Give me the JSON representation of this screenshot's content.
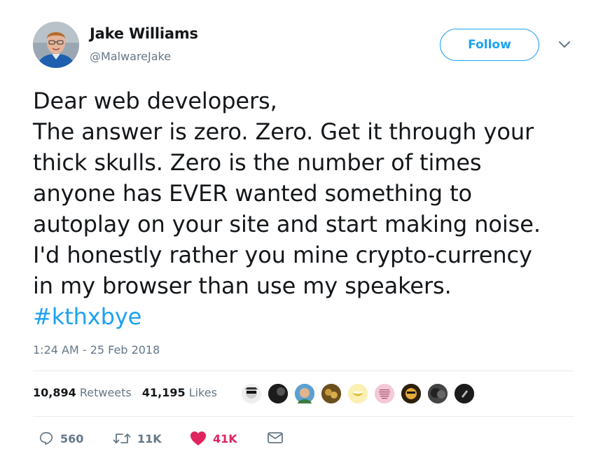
{
  "user": {
    "name": "Jake Williams",
    "handle": "@MalwareJake",
    "avatar_icon": "profile-photo"
  },
  "follow_label": "Follow",
  "tweet": {
    "lines": [
      "Dear web developers,",
      "The answer is zero. Zero. Get it through your",
      "thick skulls. Zero is the number of times",
      "anyone has EVER wanted something to",
      "autoplay on your site and start making noise.",
      "I'd honestly rather you mine crypto-currency",
      "in my browser than use my speakers."
    ],
    "hashtag": "#kthxbye"
  },
  "timestamp": "1:24 AM - 25 Feb 2018",
  "stats": {
    "retweets_count": "10,894",
    "retweets_label": "Retweets",
    "likes_count": "41,195",
    "likes_label": "Likes"
  },
  "likers": [
    "liker-avatar-1",
    "liker-avatar-2",
    "liker-avatar-3",
    "liker-avatar-4",
    "liker-avatar-5",
    "liker-avatar-6",
    "liker-avatar-7",
    "liker-avatar-8",
    "liker-avatar-9"
  ],
  "actions": {
    "reply_count": "560",
    "retweet_count": "11K",
    "like_count": "41K"
  },
  "colors": {
    "accent": "#1da1f2",
    "like": "#e0245e",
    "muted": "#657786",
    "text": "#14171a"
  }
}
